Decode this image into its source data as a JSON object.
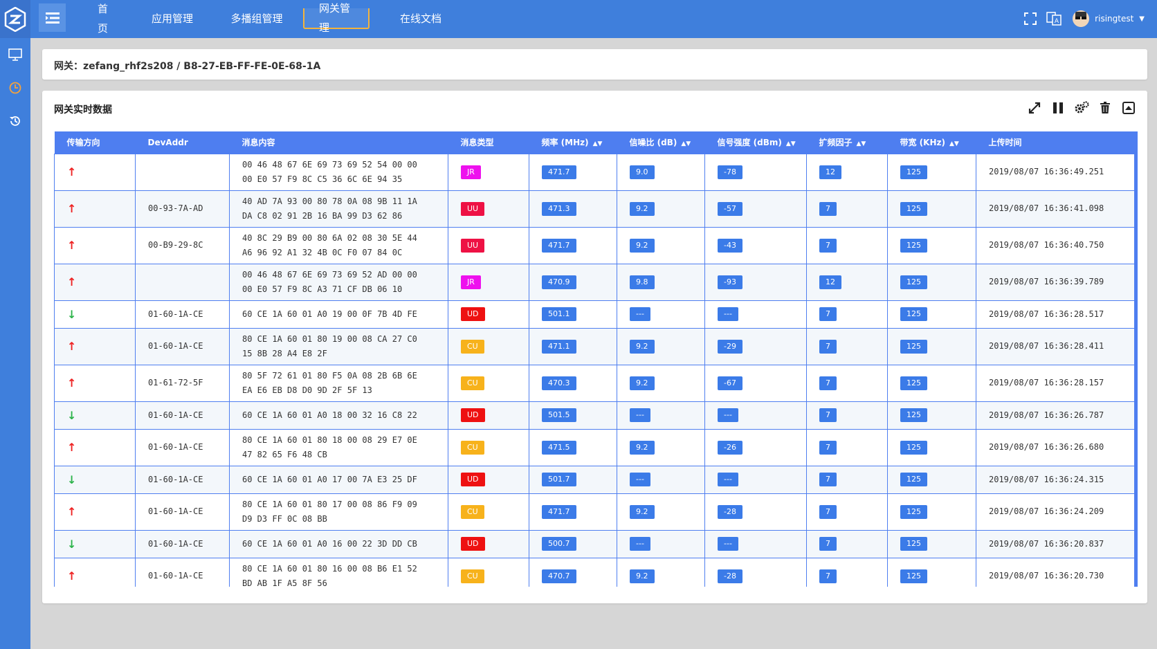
{
  "nav": {
    "items": [
      {
        "label": "首页"
      },
      {
        "label": "应用管理"
      },
      {
        "label": "多播组管理"
      },
      {
        "label": "网关管理"
      },
      {
        "label": "在线文档"
      }
    ]
  },
  "user": {
    "name": "risingtest"
  },
  "gateway": {
    "title": "网关：zefang_rhf2s208 / B8-27-EB-FF-FE-0E-68-1A"
  },
  "panel": {
    "title": "网关实时数据"
  },
  "table": {
    "headers": {
      "direction": "传输方向",
      "devaddr": "DevAddr",
      "payload": "消息内容",
      "type": "消息类型",
      "freq": "频率 (MHz)",
      "snr": "信噪比 (dB)",
      "rssi": "信号强度 (dBm)",
      "sf": "扩频因子",
      "bw": "带宽 (KHz)",
      "time": "上传时间"
    },
    "colors": {
      "JR": "#ee11ee",
      "UU": "#ee1144",
      "UD": "#ee1111",
      "CU": "#f7b21b",
      "header": "#4e7ef0",
      "up": "#ee2222",
      "down": "#2bb34a"
    },
    "rows": [
      {
        "dir": "up",
        "devaddr": "",
        "payload1": "00 46 48 67 6E 69 73 69 52 54 00 00",
        "payload2": "00 E0 57 F9 8C C5 36 6C 6E 94 35",
        "type": "JR",
        "freq": "471.7",
        "snr": "9.0",
        "rssi": "-78",
        "sf": "12",
        "bw": "125",
        "time": "2019/08/07 16:36:49.251"
      },
      {
        "dir": "up",
        "devaddr": "00-93-7A-AD",
        "payload1": "40 AD 7A 93 00 80 78 0A 08 9B 11 1A",
        "payload2": "DA C8 02 91 2B 16 BA 99 D3 62 86",
        "type": "UU",
        "freq": "471.3",
        "snr": "9.2",
        "rssi": "-57",
        "sf": "7",
        "bw": "125",
        "time": "2019/08/07 16:36:41.098"
      },
      {
        "dir": "up",
        "devaddr": "00-B9-29-8C",
        "payload1": "40 8C 29 B9 00 80 6A 02 08 30 5E 44",
        "payload2": "A6 96 92 A1 32 4B 0C F0 07 84 0C",
        "type": "UU",
        "freq": "471.7",
        "snr": "9.2",
        "rssi": "-43",
        "sf": "7",
        "bw": "125",
        "time": "2019/08/07 16:36:40.750"
      },
      {
        "dir": "up",
        "devaddr": "",
        "payload1": "00 46 48 67 6E 69 73 69 52 AD 00 00",
        "payload2": "00 E0 57 F9 8C A3 71 CF DB 06 10",
        "type": "JR",
        "freq": "470.9",
        "snr": "9.8",
        "rssi": "-93",
        "sf": "12",
        "bw": "125",
        "time": "2019/08/07 16:36:39.789"
      },
      {
        "dir": "down",
        "devaddr": "01-60-1A-CE",
        "payload1": "60 CE 1A 60 01 A0 19 00 0F 7B 4D FE",
        "payload2": "",
        "type": "UD",
        "freq": "501.1",
        "snr": "---",
        "rssi": "---",
        "sf": "7",
        "bw": "125",
        "time": "2019/08/07 16:36:28.517"
      },
      {
        "dir": "up",
        "devaddr": "01-60-1A-CE",
        "payload1": "80 CE 1A 60 01 80 19 00 08 CA 27 C0",
        "payload2": "15 8B 28 A4 E8 2F",
        "type": "CU",
        "freq": "471.1",
        "snr": "9.2",
        "rssi": "-29",
        "sf": "7",
        "bw": "125",
        "time": "2019/08/07 16:36:28.411"
      },
      {
        "dir": "up",
        "devaddr": "01-61-72-5F",
        "payload1": "80 5F 72 61 01 80 F5 0A 08 2B 6B 6E",
        "payload2": "EA E6 EB D8 D0 9D 2F 5F 13",
        "type": "CU",
        "freq": "470.3",
        "snr": "9.2",
        "rssi": "-67",
        "sf": "7",
        "bw": "125",
        "time": "2019/08/07 16:36:28.157"
      },
      {
        "dir": "down",
        "devaddr": "01-60-1A-CE",
        "payload1": "60 CE 1A 60 01 A0 18 00 32 16 C8 22",
        "payload2": "",
        "type": "UD",
        "freq": "501.5",
        "snr": "---",
        "rssi": "---",
        "sf": "7",
        "bw": "125",
        "time": "2019/08/07 16:36:26.787"
      },
      {
        "dir": "up",
        "devaddr": "01-60-1A-CE",
        "payload1": "80 CE 1A 60 01 80 18 00 08 29 E7 0E",
        "payload2": "47 82 65 F6 48 CB",
        "type": "CU",
        "freq": "471.5",
        "snr": "9.2",
        "rssi": "-26",
        "sf": "7",
        "bw": "125",
        "time": "2019/08/07 16:36:26.680"
      },
      {
        "dir": "down",
        "devaddr": "01-60-1A-CE",
        "payload1": "60 CE 1A 60 01 A0 17 00 7A E3 25 DF",
        "payload2": "",
        "type": "UD",
        "freq": "501.7",
        "snr": "---",
        "rssi": "---",
        "sf": "7",
        "bw": "125",
        "time": "2019/08/07 16:36:24.315"
      },
      {
        "dir": "up",
        "devaddr": "01-60-1A-CE",
        "payload1": "80 CE 1A 60 01 80 17 00 08 86 F9 09",
        "payload2": "D9 D3 FF 0C 08 BB",
        "type": "CU",
        "freq": "471.7",
        "snr": "9.2",
        "rssi": "-28",
        "sf": "7",
        "bw": "125",
        "time": "2019/08/07 16:36:24.209"
      },
      {
        "dir": "down",
        "devaddr": "01-60-1A-CE",
        "payload1": "60 CE 1A 60 01 A0 16 00 22 3D DD CB",
        "payload2": "",
        "type": "UD",
        "freq": "500.7",
        "snr": "---",
        "rssi": "---",
        "sf": "7",
        "bw": "125",
        "time": "2019/08/07 16:36:20.837"
      },
      {
        "dir": "up",
        "devaddr": "01-60-1A-CE",
        "payload1": "80 CE 1A 60 01 80 16 00 08 B6 E1 52",
        "payload2": "BD AB 1F A5 8F 56",
        "type": "CU",
        "freq": "470.7",
        "snr": "9.2",
        "rssi": "-28",
        "sf": "7",
        "bw": "125",
        "time": "2019/08/07 16:36:20.730"
      }
    ]
  }
}
